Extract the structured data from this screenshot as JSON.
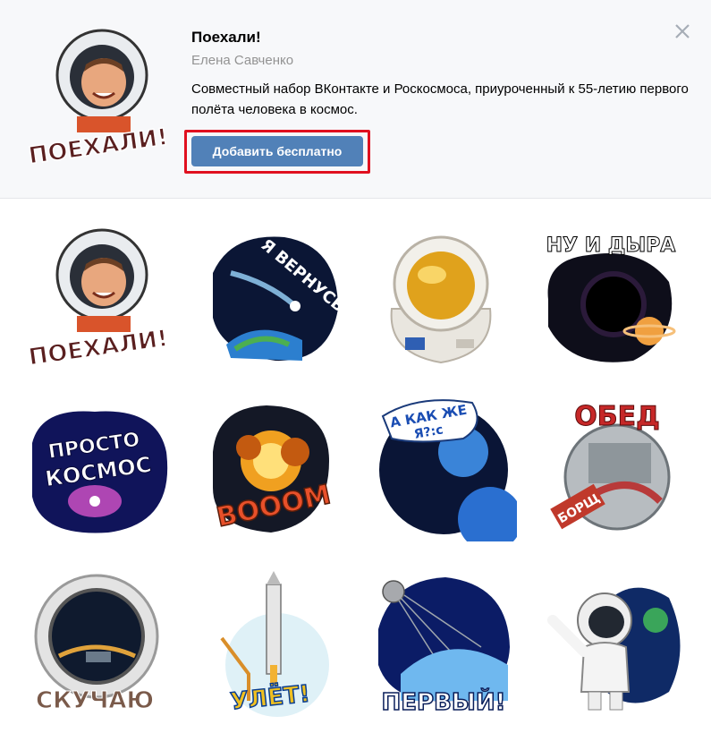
{
  "pack": {
    "title": "Поехали!",
    "author": "Елена Савченко",
    "description": "Совместный набор ВКонтакте и Роскосмоса, приуроченный к 55-летию первого полёта человека в космос.",
    "add_button_label": "Добавить бесплатно",
    "close_icon": "close-icon",
    "cover_sticker_caption": "ПОЕХАЛИ!"
  },
  "stickers": [
    {
      "id": "poekhali",
      "caption": "ПОЕХАЛИ!"
    },
    {
      "id": "ya-vernus",
      "caption": "Я ВЕРНУСЬ!"
    },
    {
      "id": "astronaut-helmet",
      "caption": ""
    },
    {
      "id": "nu-i-dyra",
      "caption": "НУ И ДЫРА"
    },
    {
      "id": "prosto-kosmos",
      "caption_line1": "ПРОСТО",
      "caption_line2": "КОСМОС"
    },
    {
      "id": "booom",
      "caption": "BOOOM"
    },
    {
      "id": "a-kak-zhe-ya",
      "caption_line1": "А КАК ЖЕ",
      "caption_line2": "Я?:с"
    },
    {
      "id": "obed",
      "caption": "ОБЕД",
      "tube_label": "БОРЩ"
    },
    {
      "id": "skuchayu",
      "caption": "СКУЧАЮ"
    },
    {
      "id": "ulet",
      "caption": "УЛЁТ!"
    },
    {
      "id": "pervyy",
      "caption": "ПЕРВЫЙ!"
    },
    {
      "id": "waving-astronaut",
      "caption": ""
    }
  ]
}
